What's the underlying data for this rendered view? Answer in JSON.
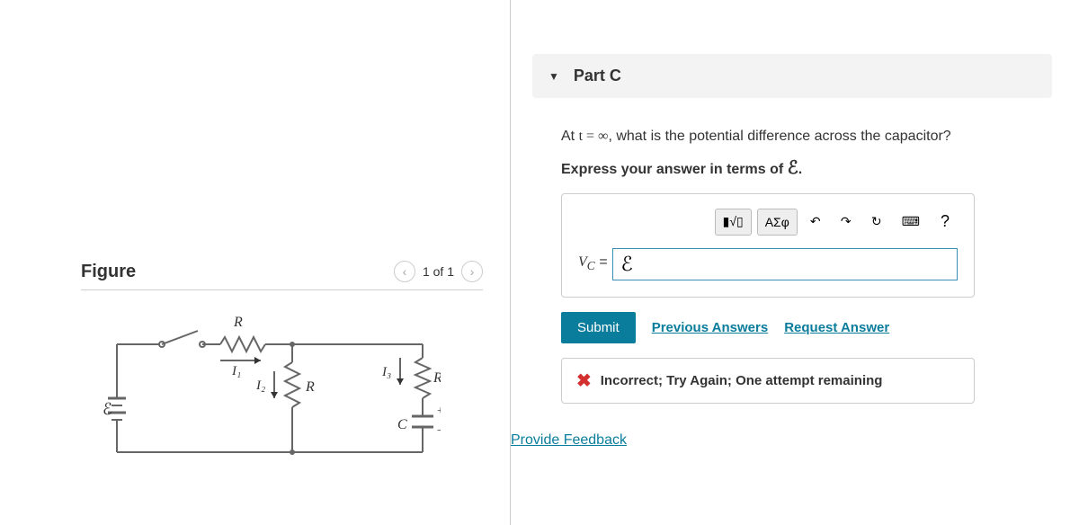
{
  "figure": {
    "title": "Figure",
    "pager_text": "1 of 1",
    "labels": {
      "R_top": "R",
      "I1": "I₁",
      "I2": "I₂",
      "R_mid": "R",
      "I3": "I₃",
      "R_right": "R",
      "plusQ": "+Q",
      "minusQ": "−Q",
      "C": "C",
      "emf": "ℰ"
    }
  },
  "part": {
    "caret": "▼",
    "title": "Part C",
    "question_line1_prefix": "At ",
    "question_line1_math": "t = ∞",
    "question_line1_suffix": ", what is the potential difference across the capacitor?",
    "question_line2_prefix": "Express your answer in terms of ",
    "question_line2_symbol": "ℰ",
    "question_line2_suffix": "."
  },
  "toolbar": {
    "templates": "▮√▯",
    "greek": "ΑΣφ",
    "undo": "↶",
    "redo": "↷",
    "reset": "↻",
    "keyboard": "⌨",
    "help": "?"
  },
  "answer": {
    "label_prefix": "V",
    "label_sub": "C",
    "label_eq": " = ",
    "value": "ℰ"
  },
  "buttons": {
    "submit": "Submit",
    "previous": "Previous Answers",
    "request": "Request Answer"
  },
  "feedback": {
    "icon": "✖",
    "text": "Incorrect; Try Again; One attempt remaining"
  },
  "provide_feedback": "Provide Feedback"
}
